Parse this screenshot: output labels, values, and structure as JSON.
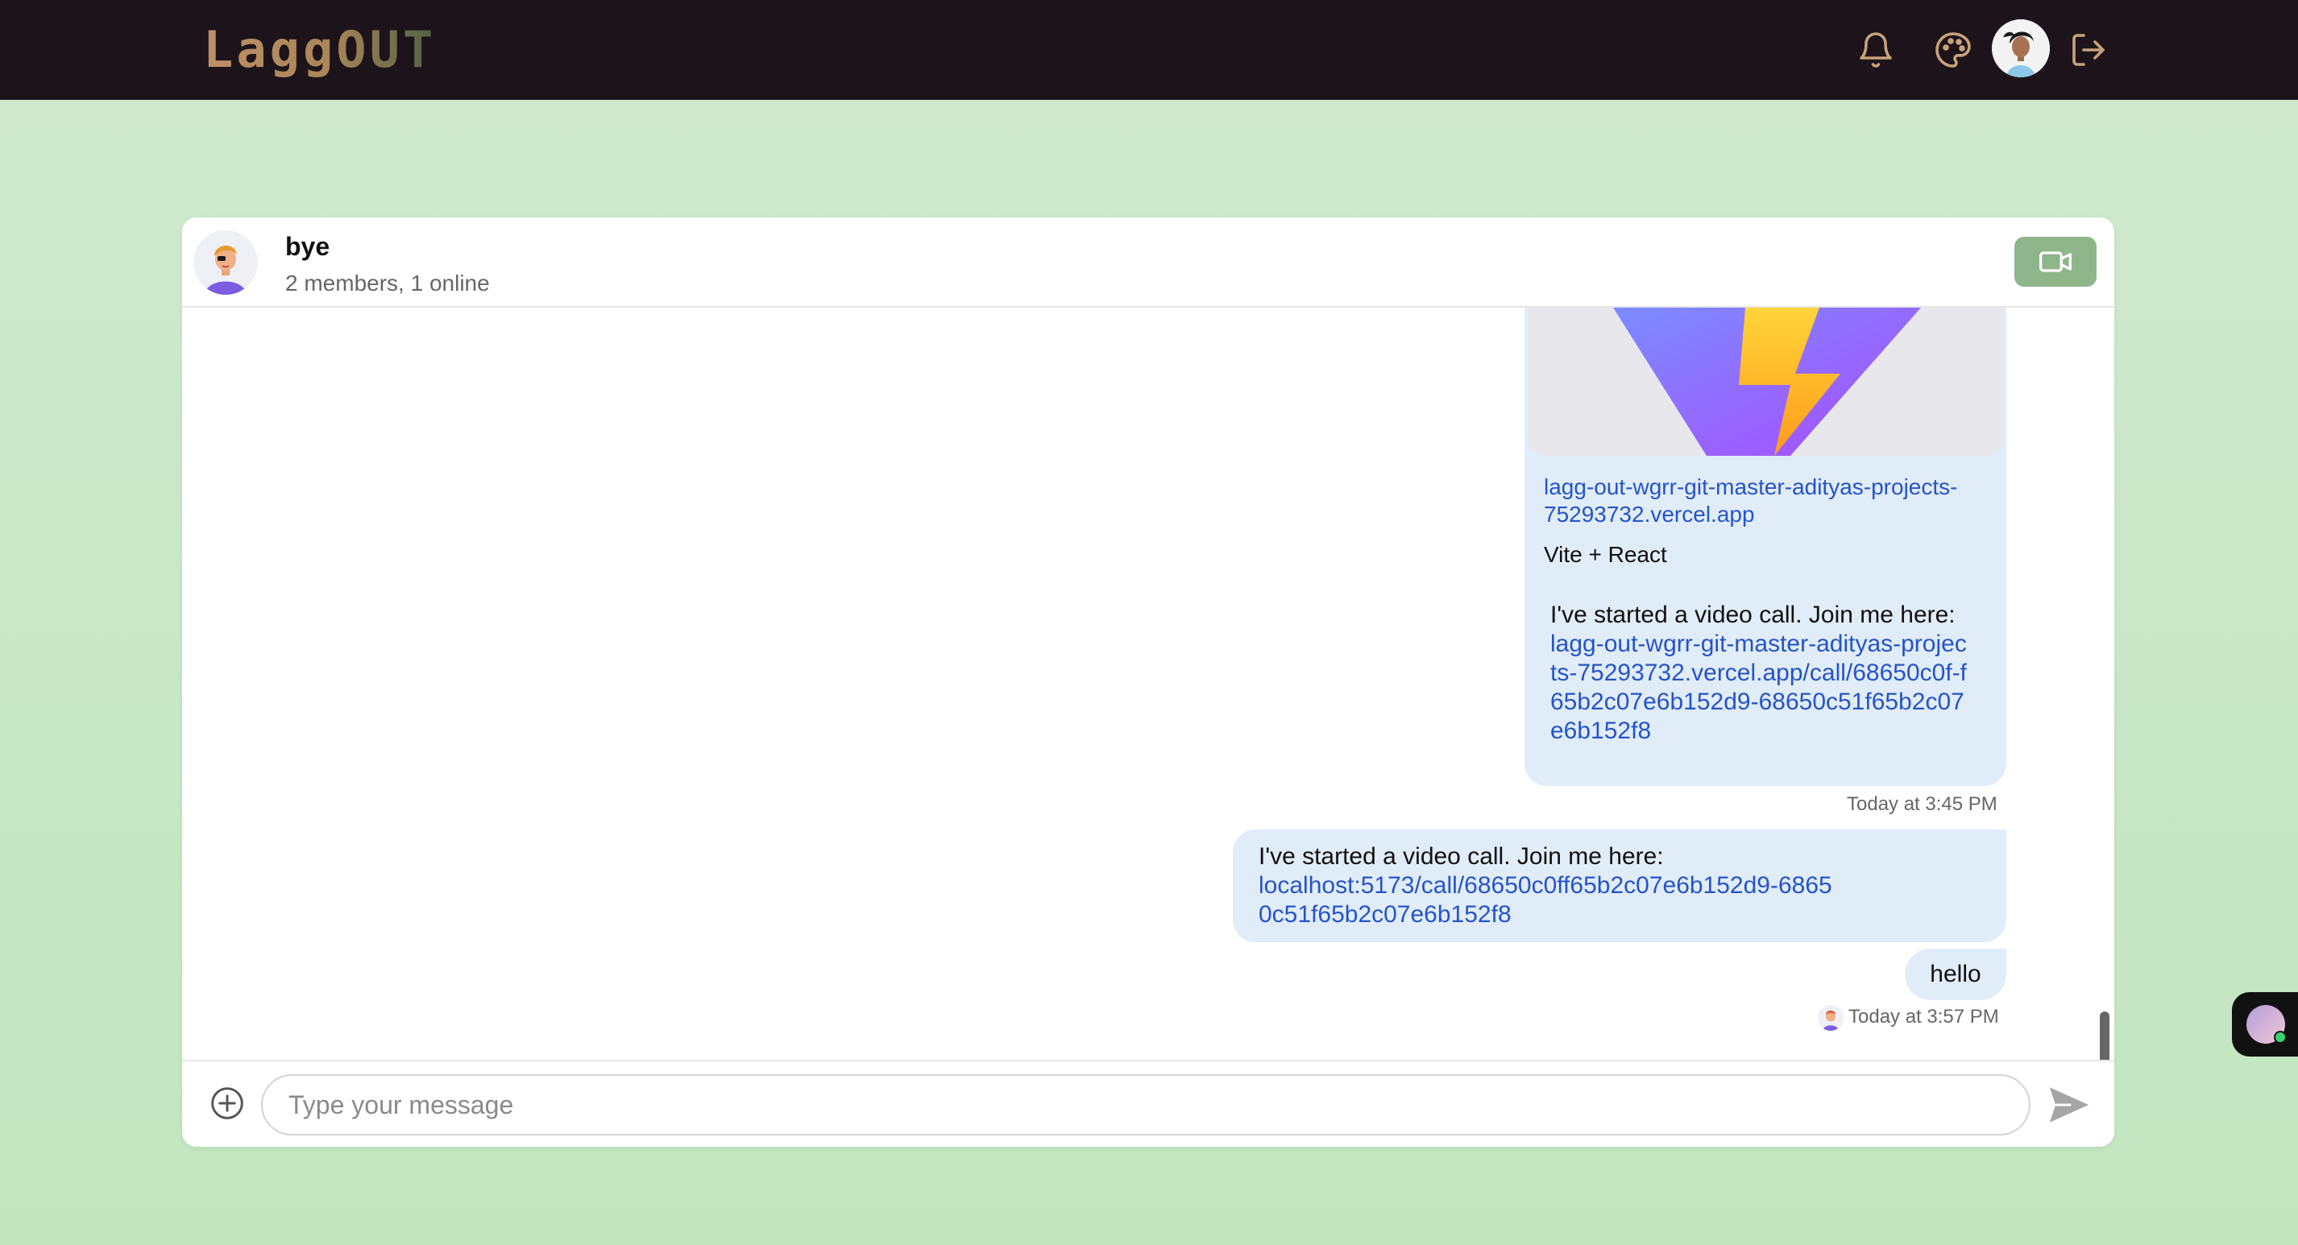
{
  "app": {
    "logo_text": "LaggOUT"
  },
  "nav": {
    "icons": [
      "bell-icon",
      "palette-icon",
      "user-avatar",
      "logout-icon"
    ]
  },
  "chat": {
    "name": "bye",
    "subtitle": "2 members, 1 online"
  },
  "messages": {
    "preview": {
      "link_title": "lagg-out-wgrr-git-master-adityas-projects-75293732.vercel.app",
      "site_name": "Vite + React",
      "call_text": "I've started a video call. Join me here:",
      "call_link": "lagg-out-wgrr-git-master-adityas-projects-75293732.vercel.app/call/68650c0f-f65b2c07e6b152d9-68650c51f65b2c07e6b152f8",
      "timestamp": "Today at 3:45 PM"
    },
    "call_msg": {
      "text": "I've started a video call. Join me here:",
      "link": "localhost:5173/call/68650c0ff65b2c07e6b152d9-68650c51f65b2c07e6b152f8"
    },
    "hello": {
      "text": "hello",
      "timestamp": "Today at 3:57 PM"
    }
  },
  "composer": {
    "placeholder": "Type your message"
  },
  "colors": {
    "accent": "#8fb58b",
    "bubble": "#e1ecf9",
    "link": "#2554c7",
    "topbar": "#1c141a"
  }
}
